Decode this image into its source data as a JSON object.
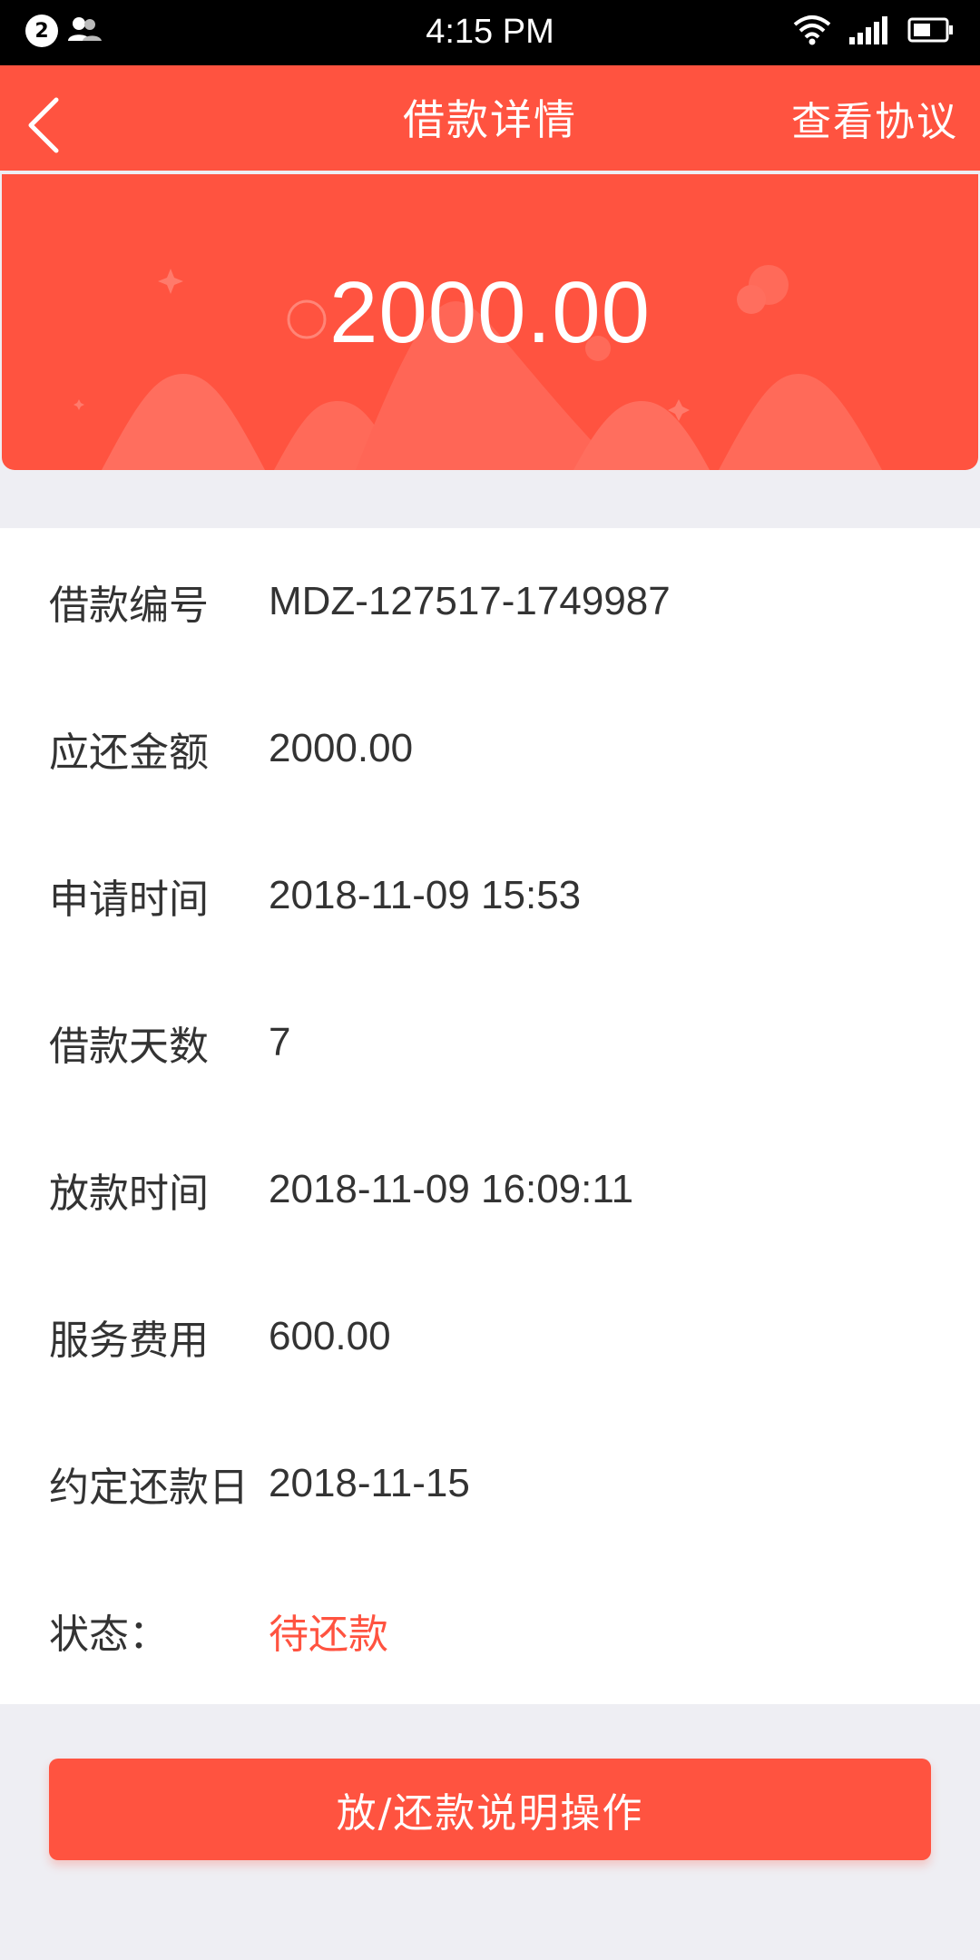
{
  "status_bar": {
    "notification_count": "2",
    "time": "4:15 PM"
  },
  "nav": {
    "title": "借款详情",
    "action": "查看协议"
  },
  "hero": {
    "amount": "2000.00"
  },
  "details": [
    {
      "label": "借款编号",
      "value": "MDZ-127517-1749987"
    },
    {
      "label": "应还金额",
      "value": "2000.00"
    },
    {
      "label": "申请时间",
      "value": "2018-11-09 15:53"
    },
    {
      "label": "借款天数",
      "value": "7"
    },
    {
      "label": "放款时间",
      "value": "2018-11-09 16:09:11"
    },
    {
      "label": "服务费用",
      "value": "600.00"
    },
    {
      "label": "约定还款日",
      "value": "2018-11-15"
    },
    {
      "label": "状态：",
      "value": "待还款"
    }
  ],
  "button": {
    "label": "放/还款说明操作"
  },
  "colors": {
    "accent": "#ff5340",
    "background": "#eeeef3",
    "text": "#333333"
  }
}
